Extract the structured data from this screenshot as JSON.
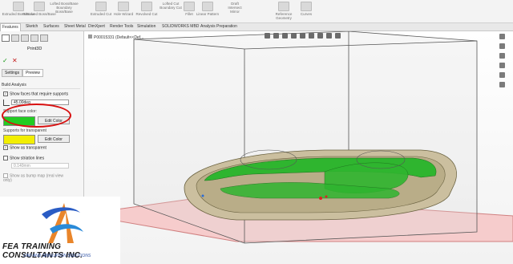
{
  "ribbon": {
    "items": [
      "Extruded Boss/Base",
      "Revolved Boss/Base",
      "Lofted Boss/Base",
      "Boundary Boss/Base",
      "Extruded Cut",
      "Hole Wizard",
      "Revolved Cut",
      "Lofted Cut",
      "Boundary Cut",
      "Fillet",
      "Linear Pattern",
      "Draft",
      "Intersect",
      "Mirror",
      "Reference Geometry",
      "Curves"
    ]
  },
  "tabs": [
    "Features",
    "Sketch",
    "Surfaces",
    "Sheet Metal",
    "DimXpert",
    "Render Tools",
    "Simulation",
    "SOLIDWORKS MBD",
    "Analysis Preparation"
  ],
  "active_tab": "Features",
  "panel": {
    "title": "Print3D",
    "ok": "✓",
    "cancel": "✕",
    "subtabs": [
      "Settings",
      "Preview"
    ],
    "active_subtab": "Preview",
    "section": "Build Analysis",
    "show_support_label": "Show faces that require supports",
    "angle_value": "45.00deg",
    "support_face_color_label": "Support face color:",
    "support_face_color": "#22cc22",
    "edit_color_1": "Edit Color",
    "supports_color_label": "Supports for transparent",
    "supports_color": "#f2ee00",
    "edit_color_2": "Edit Color",
    "show_transparent_label": "Show as transparent",
    "show_striation_label": "Show striation lines",
    "striation_value": "0.140mm",
    "bump_label": "Show as bump map (real view only)"
  },
  "tree": {
    "label": "P00015331 (Default<<Def..."
  },
  "logo": {
    "name": "FEA TRAINING CONSULTANTS INC.",
    "tagline": "CAD AND SIMULATION SOLUTIONS"
  },
  "colors": {
    "accent_red": "#d81010",
    "model_green": "#22aa22",
    "build_plate": "#f4c2c2"
  }
}
